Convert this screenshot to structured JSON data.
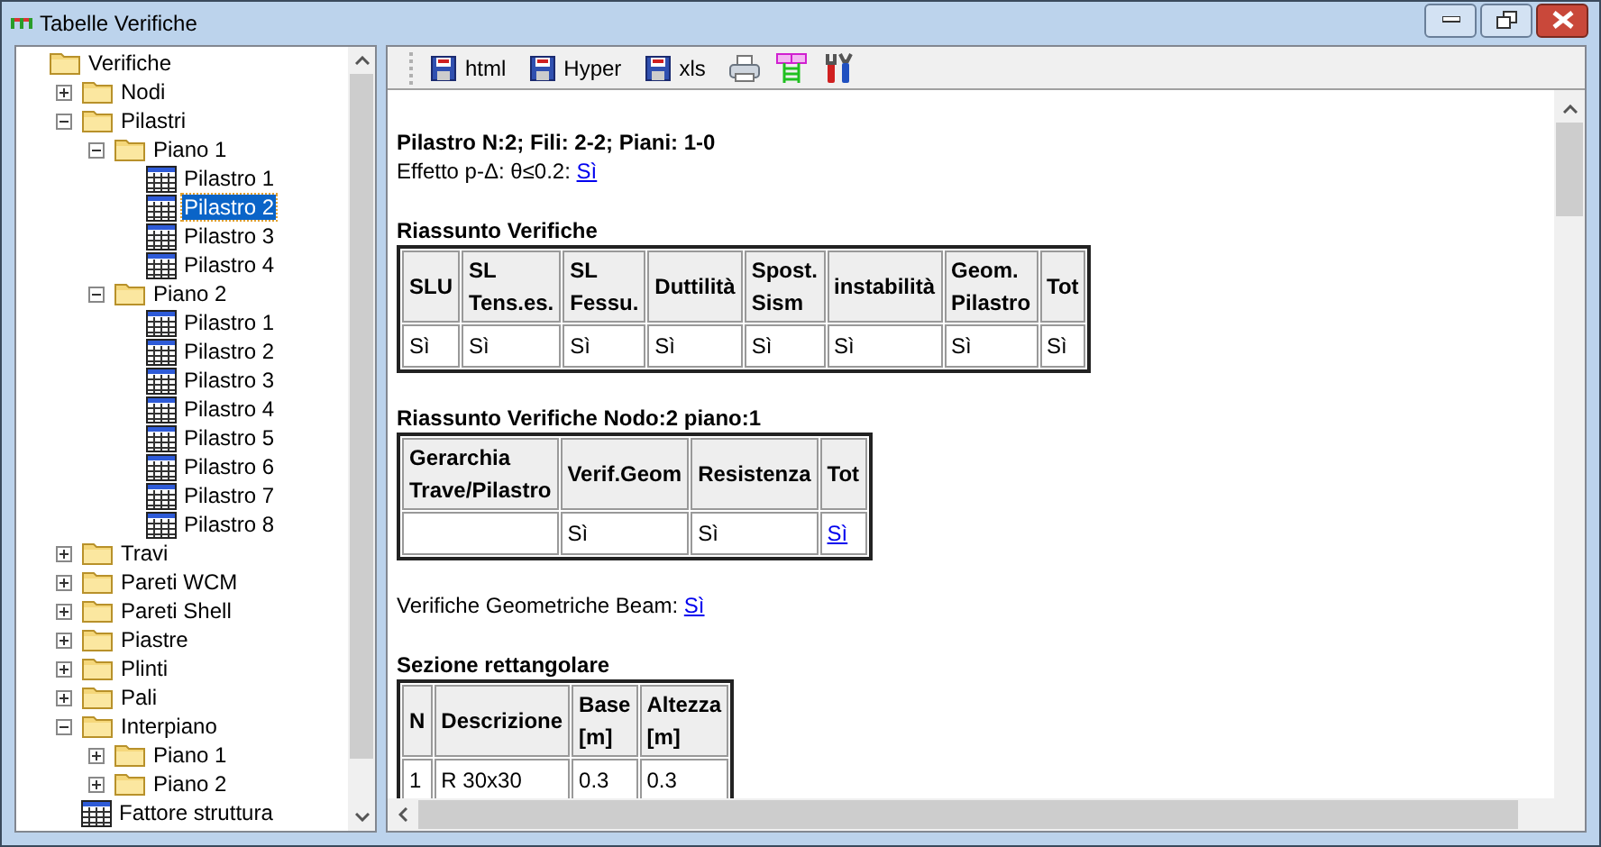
{
  "window": {
    "title": "Tabelle Verifiche"
  },
  "tree": [
    {
      "label": "Verifiche",
      "kind": "folder",
      "selected": false,
      "children": [
        {
          "label": "Nodi",
          "kind": "folder",
          "expanded": false,
          "selected": false
        },
        {
          "label": "Pilastri",
          "kind": "folder",
          "expanded": true,
          "selected": false,
          "children": [
            {
              "label": "Piano 1",
              "kind": "folder",
              "expanded": true,
              "selected": false,
              "children": [
                {
                  "label": "Pilastro 1",
                  "kind": "table",
                  "selected": false
                },
                {
                  "label": "Pilastro 2",
                  "kind": "table",
                  "selected": true
                },
                {
                  "label": "Pilastro 3",
                  "kind": "table",
                  "selected": false
                },
                {
                  "label": "Pilastro 4",
                  "kind": "table",
                  "selected": false
                }
              ]
            },
            {
              "label": "Piano 2",
              "kind": "folder",
              "expanded": true,
              "selected": false,
              "children": [
                {
                  "label": "Pilastro 1",
                  "kind": "table",
                  "selected": false
                },
                {
                  "label": "Pilastro 2",
                  "kind": "table",
                  "selected": false
                },
                {
                  "label": "Pilastro 3",
                  "kind": "table",
                  "selected": false
                },
                {
                  "label": "Pilastro 4",
                  "kind": "table",
                  "selected": false
                },
                {
                  "label": "Pilastro 5",
                  "kind": "table",
                  "selected": false
                },
                {
                  "label": "Pilastro 6",
                  "kind": "table",
                  "selected": false
                },
                {
                  "label": "Pilastro 7",
                  "kind": "table",
                  "selected": false
                },
                {
                  "label": "Pilastro 8",
                  "kind": "table",
                  "selected": false
                }
              ]
            }
          ]
        },
        {
          "label": "Travi",
          "kind": "folder",
          "expanded": false,
          "selected": false
        },
        {
          "label": "Pareti WCM",
          "kind": "folder",
          "expanded": false,
          "selected": false
        },
        {
          "label": "Pareti Shell",
          "kind": "folder",
          "expanded": false,
          "selected": false
        },
        {
          "label": "Piastre",
          "kind": "folder",
          "expanded": false,
          "selected": false
        },
        {
          "label": "Plinti",
          "kind": "folder",
          "expanded": false,
          "selected": false
        },
        {
          "label": "Pali",
          "kind": "folder",
          "expanded": false,
          "selected": false
        },
        {
          "label": "Interpiano",
          "kind": "folder",
          "expanded": true,
          "selected": false,
          "children": [
            {
              "label": "Piano 1",
              "kind": "folder",
              "expanded": false,
              "selected": false
            },
            {
              "label": "Piano 2",
              "kind": "folder",
              "expanded": false,
              "selected": false
            }
          ]
        },
        {
          "label": "Fattore struttura",
          "kind": "table",
          "selected": false
        }
      ]
    }
  ],
  "toolbar": [
    {
      "kind": "save",
      "label": "html"
    },
    {
      "kind": "save",
      "label": "Hyper"
    },
    {
      "kind": "save",
      "label": "xls"
    },
    {
      "kind": "print"
    },
    {
      "kind": "columns"
    },
    {
      "kind": "tools"
    }
  ],
  "content": [
    {
      "kind": "heading",
      "text": "Pilastro N:2; Fili: 2-2; Piani: 1-0"
    },
    {
      "kind": "line",
      "text": "Effetto p-Δ: θ≤0.2:",
      "link": "Sì"
    },
    {
      "kind": "heading",
      "text": "Riassunto Verifiche",
      "table": {
        "columns": [
          "SLU",
          "SL Tens.es.",
          "SL Fessu.",
          "Duttilità",
          "Spost. Sism",
          "instabilità",
          "Geom. Pilastro",
          "Tot"
        ],
        "rows": [
          [
            {
              "text": "Sì",
              "link": false
            },
            {
              "text": "Sì",
              "link": false
            },
            {
              "text": "Sì",
              "link": false
            },
            {
              "text": "Sì",
              "link": false
            },
            {
              "text": "Sì",
              "link": false
            },
            {
              "text": "Sì",
              "link": false
            },
            {
              "text": "Sì",
              "link": false
            },
            {
              "text": "Sì",
              "link": false
            }
          ]
        ]
      }
    },
    {
      "kind": "heading",
      "text": "Riassunto Verifiche Nodo:2 piano:1",
      "table": {
        "columns": [
          "Gerarchia Trave/Pilastro",
          "Verif.Geom",
          "Resistenza",
          "Tot"
        ],
        "rows": [
          [
            null,
            {
              "text": "Sì",
              "link": false
            },
            {
              "text": "Sì",
              "link": false
            },
            {
              "text": "Sì",
              "link": true
            }
          ]
        ]
      }
    },
    {
      "kind": "line",
      "text": "Verifiche Geometriche Beam:",
      "link": "Sì"
    },
    {
      "kind": "heading",
      "text": "Sezione rettangolare",
      "table": {
        "columns": [
          "N",
          "Descrizione",
          "Base [m]",
          "Altezza [m]"
        ],
        "rows": [
          [
            {
              "text": "1",
              "link": false
            },
            {
              "text": "R 30x30",
              "link": false
            },
            {
              "text": "0.3",
              "link": false
            },
            {
              "text": "0.3",
              "link": false
            }
          ]
        ]
      }
    }
  ]
}
